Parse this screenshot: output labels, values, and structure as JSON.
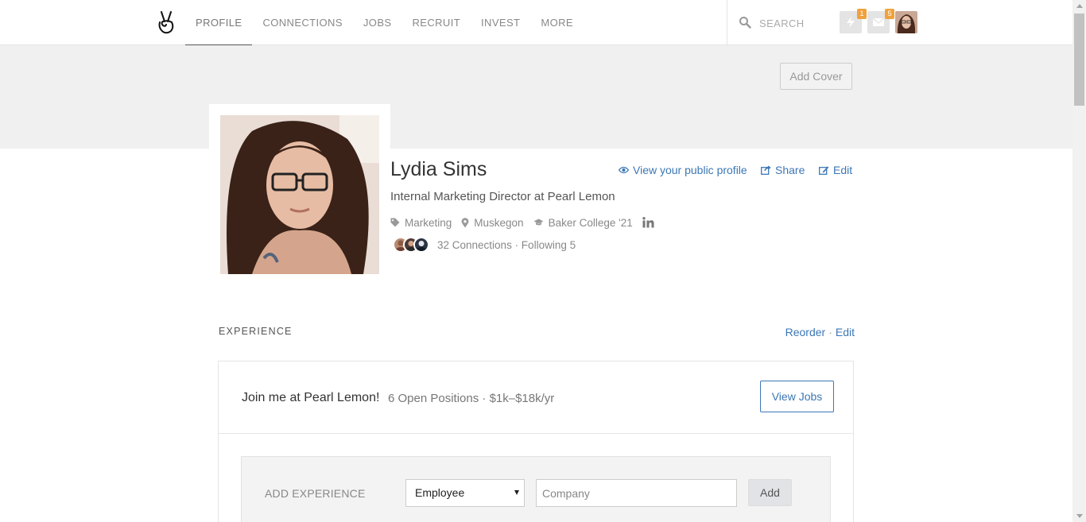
{
  "nav": {
    "items": [
      {
        "label": "PROFILE",
        "active": true
      },
      {
        "label": "CONNECTIONS",
        "active": false
      },
      {
        "label": "JOBS",
        "active": false
      },
      {
        "label": "RECRUIT",
        "active": false
      },
      {
        "label": "INVEST",
        "active": false
      },
      {
        "label": "MORE",
        "active": false
      }
    ],
    "search_placeholder": "SEARCH",
    "notifications_count": "1",
    "messages_count": "5",
    "badge_color": "#f0a13c"
  },
  "cover": {
    "add_cover_label": "Add Cover"
  },
  "profile": {
    "name": "Lydia Sims",
    "actions": {
      "public_profile": "View your public profile",
      "share": "Share",
      "edit": "Edit"
    },
    "headline": "Internal Marketing Director at Pearl Lemon",
    "tags": {
      "market": "Marketing",
      "location": "Muskegon",
      "school": "Baker College '21"
    },
    "connections_text": "32 Connections · Following 5",
    "link_color": "#3c77b5"
  },
  "experience": {
    "title": "EXPERIENCE",
    "reorder_label": "Reorder",
    "edit_label": "Edit",
    "join_title": "Join me at Pearl Lemon!",
    "join_meta": "6 Open Positions · $1k–$18k/yr",
    "view_jobs_label": "View Jobs",
    "add_label": "ADD EXPERIENCE",
    "role_selected": "Employee",
    "company_placeholder": "Company",
    "add_button_label": "Add"
  }
}
